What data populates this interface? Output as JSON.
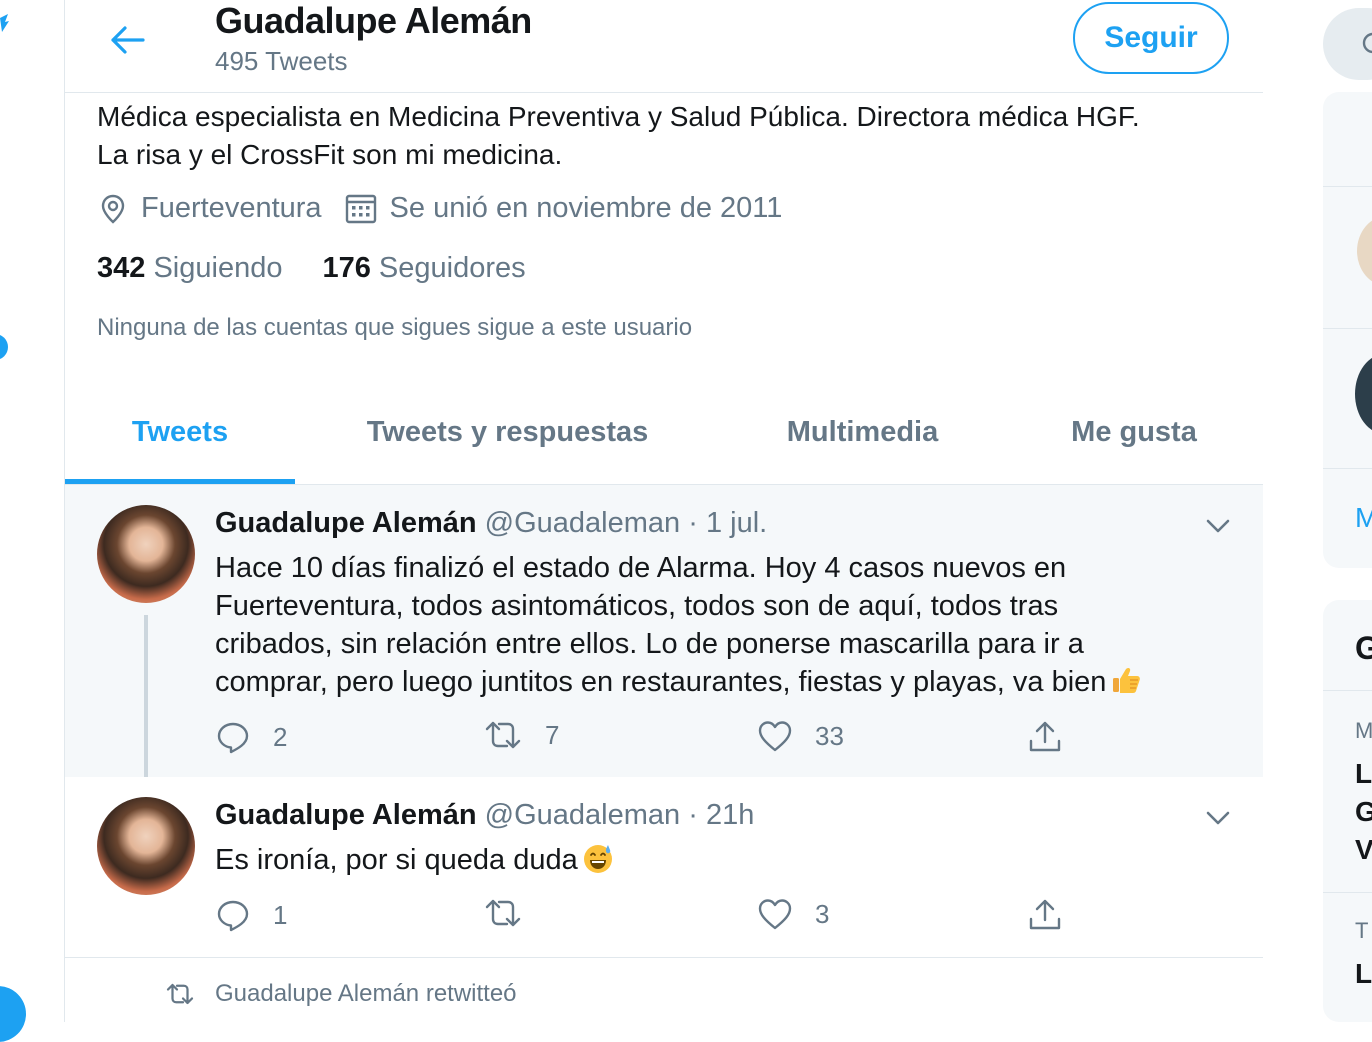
{
  "header": {
    "back_icon": "arrow-left-icon",
    "name": "Guadalupe Alemán",
    "tweet_count": "495 Tweets",
    "follow_label": "Seguir"
  },
  "profile": {
    "bio_line1": "Médica especialista en Medicina Preventiva y Salud Pública. Directora médica HGF.",
    "bio_line2": "La risa y el CrossFit son mi medicina.",
    "location": "Fuerteventura",
    "joined": "Se unió en noviembre de 2011",
    "following_count": "342",
    "following_label": "Siguiendo",
    "followers_count": "176",
    "followers_label": "Seguidores",
    "mutuals_note": "Ninguna de las cuentas que sigues sigue a este usuario"
  },
  "tabs": [
    {
      "label": "Tweets",
      "active": true
    },
    {
      "label": "Tweets y respuestas",
      "active": false
    },
    {
      "label": "Multimedia",
      "active": false
    },
    {
      "label": "Me gusta",
      "active": false
    }
  ],
  "tweets": [
    {
      "name": "Guadalupe Alemán",
      "handle": "@Guadaleman",
      "time": "1 jul.",
      "lines": [
        "Hace 10 días finalizó el estado de Alarma. Hoy 4 casos nuevos en",
        "Fuerteventura, todos asintomáticos, todos son de aquí, todos tras",
        "cribados, sin relación entre ellos. Lo de ponerse mascarilla para ir a",
        "comprar, pero luego juntitos en restaurantes, fiestas y playas, va bien"
      ],
      "emoji": "thumbs-up-emoji",
      "replies": "2",
      "retweets": "7",
      "likes": "33"
    },
    {
      "name": "Guadalupe Alemán",
      "handle": "@Guadaleman",
      "time": "21h",
      "lines": [
        "Es ironía, por si queda duda"
      ],
      "emoji": "grinning-sweat-emoji",
      "replies": "1",
      "retweets": "",
      "likes": "3"
    }
  ],
  "retweet_note": "Guadalupe Alemán retwitteó",
  "right_column": {
    "cropped_letters": [
      "M",
      "G",
      "M",
      "L",
      "G",
      "V",
      "T",
      "L"
    ]
  },
  "colors": {
    "accent": "#1da1f2",
    "secondary_text": "#657786",
    "primary_text": "#14171a",
    "highlight_bg": "#f5f8fa",
    "border": "#e1e8ed"
  }
}
